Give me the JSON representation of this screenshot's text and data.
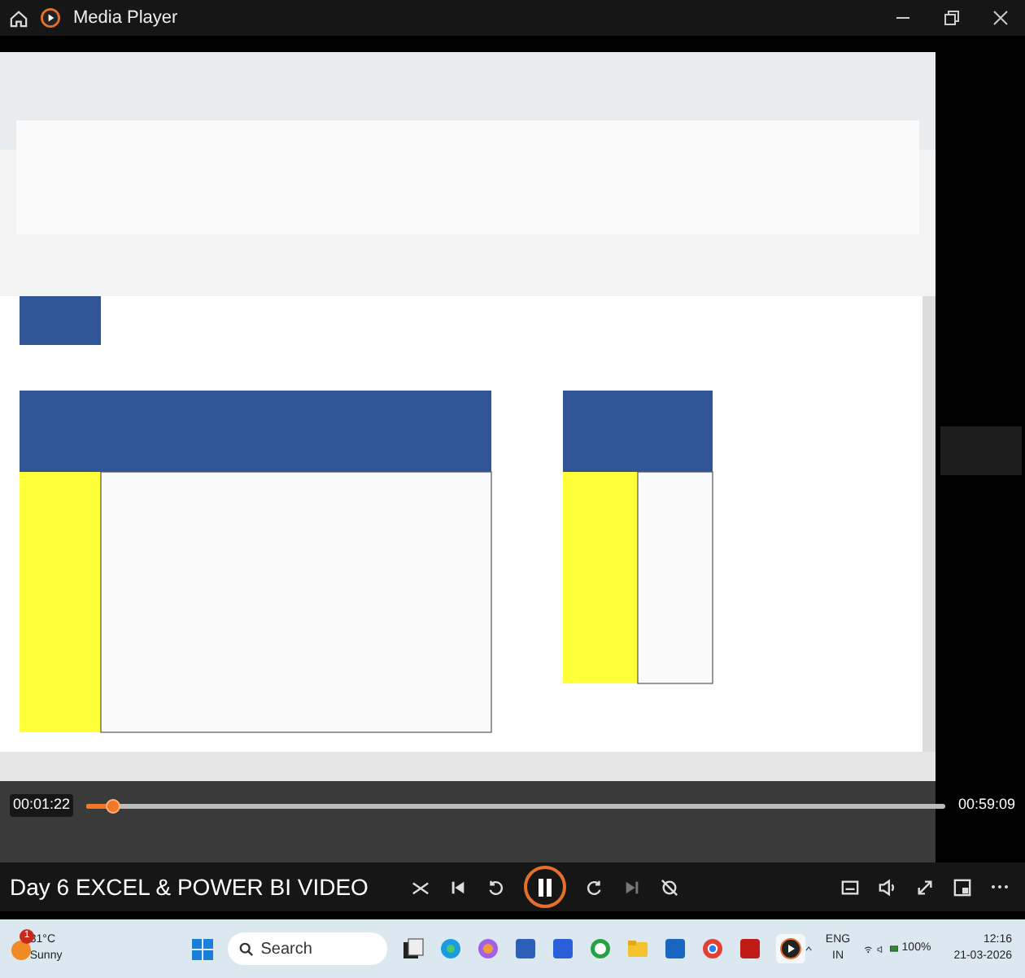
{
  "window": {
    "title": "Media Player"
  },
  "playback": {
    "elapsed": "00:01:22",
    "duration": "00:59:09",
    "level": 0.03,
    "playing": true
  },
  "now_playing": {
    "title": "Day 6 EXCEL & POWER BI VIDEO"
  },
  "taskbar": {
    "weather": {
      "temperature": "31°C",
      "condition": "Sunny",
      "alert": "1"
    },
    "search": {
      "placeholder": "Search"
    },
    "language": {
      "code": "ENG",
      "region": "IN"
    },
    "battery": "100%",
    "clock": {
      "time": "12:16",
      "date": "21-03-2026"
    }
  }
}
